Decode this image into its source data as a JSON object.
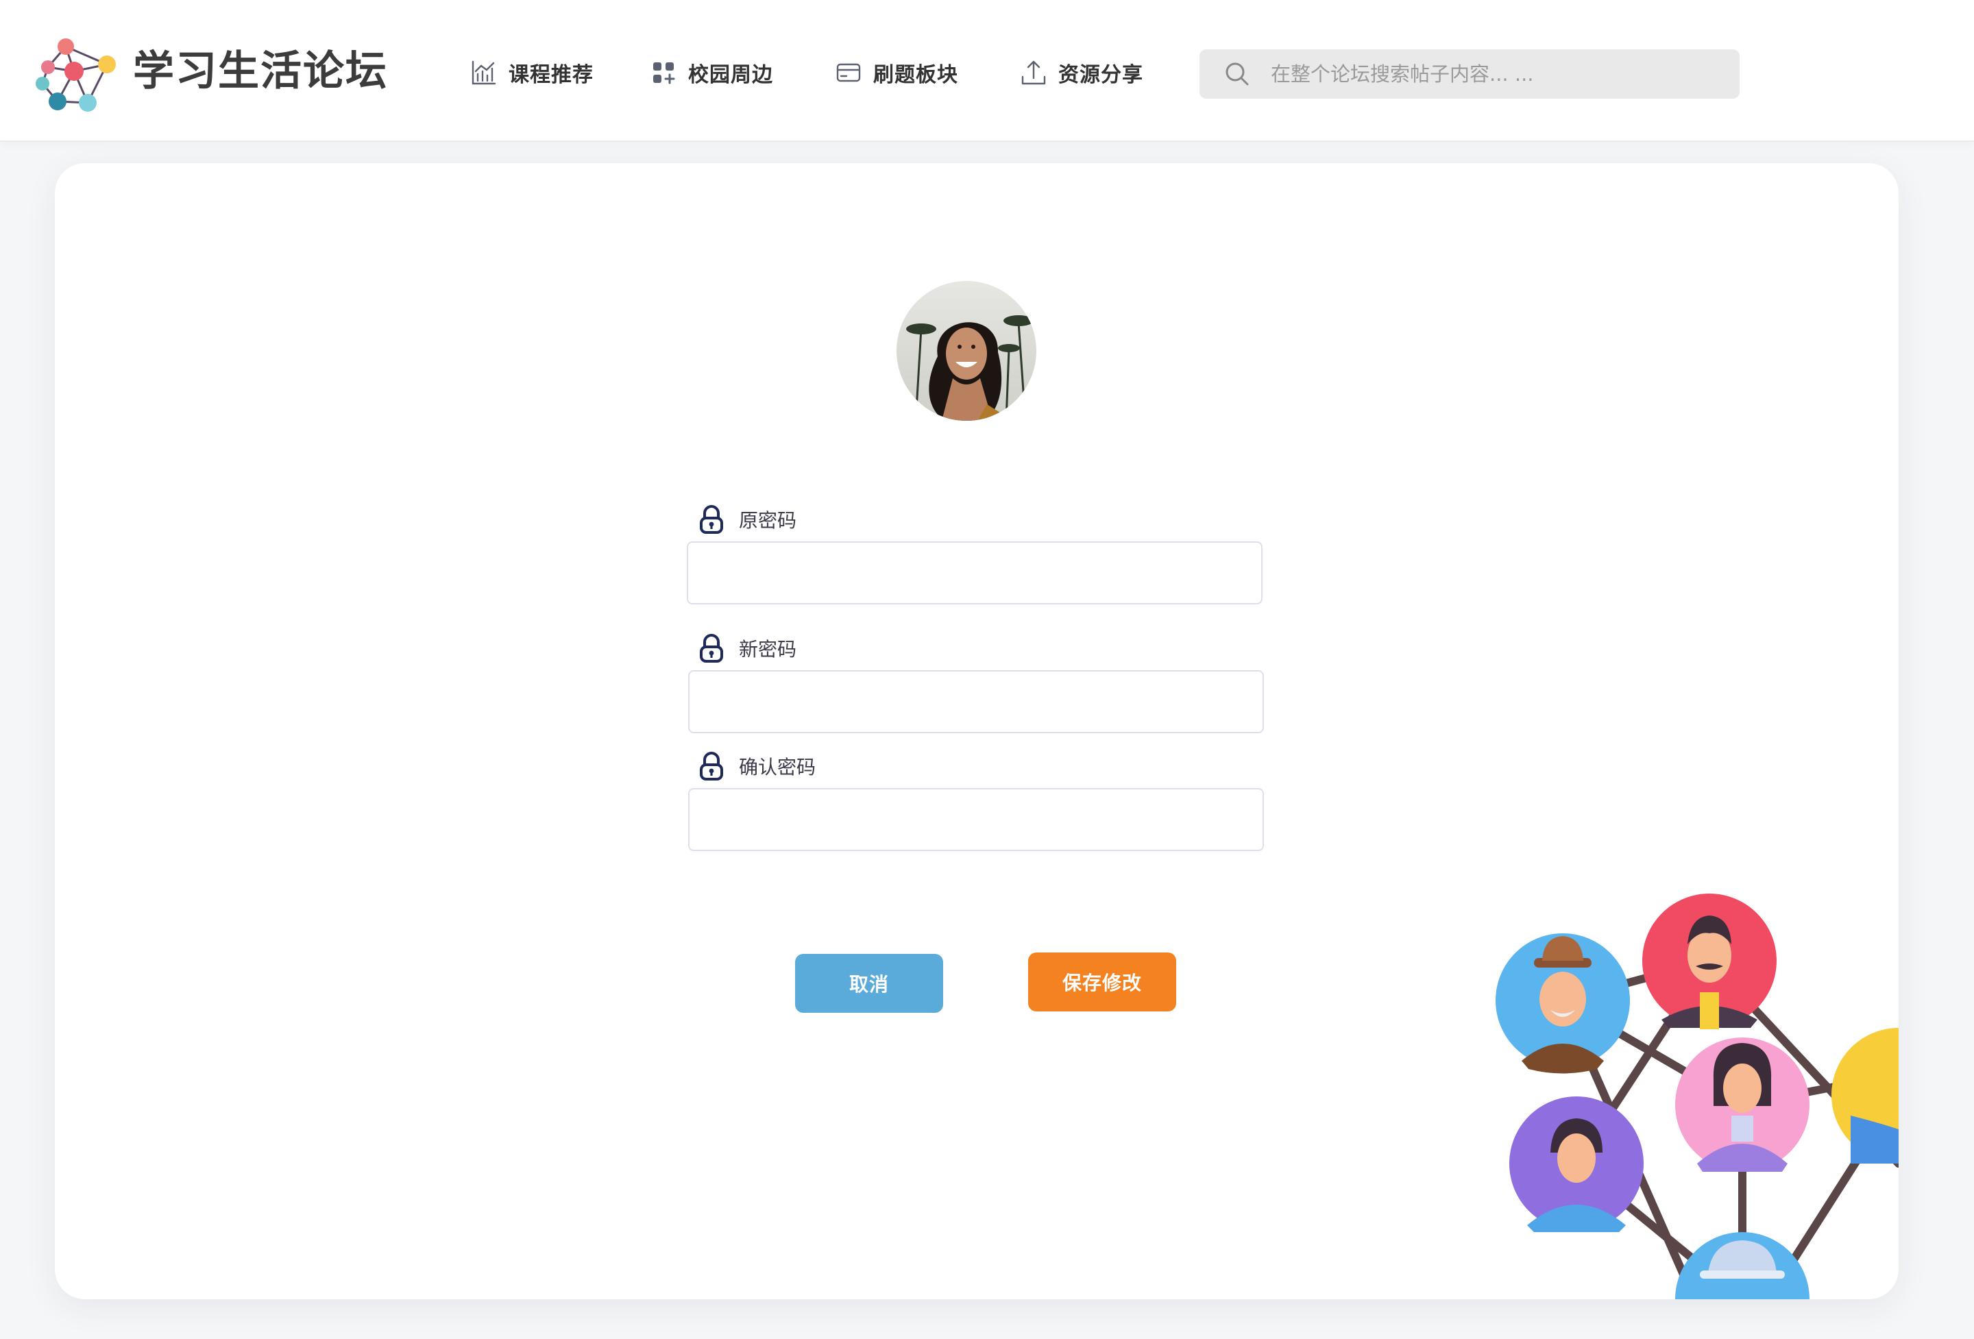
{
  "header": {
    "brand": "学习生活论坛",
    "nav": [
      {
        "label": "课程推荐",
        "icon": "chart-icon"
      },
      {
        "label": "校园周边",
        "icon": "grid-icon"
      },
      {
        "label": "刷题板块",
        "icon": "card-icon"
      },
      {
        "label": "资源分享",
        "icon": "upload-icon"
      }
    ],
    "search": {
      "placeholder": "在整个论坛搜索帖子内容... ...",
      "value": ""
    }
  },
  "form": {
    "fields": [
      {
        "label": "原密码",
        "value": ""
      },
      {
        "label": "新密码",
        "value": ""
      },
      {
        "label": "确认密码",
        "value": ""
      }
    ],
    "cancel_label": "取消",
    "save_label": "保存修改"
  },
  "colors": {
    "primary_text": "#3c3c3c",
    "cancel_button": "#5aabd9",
    "save_button": "#f58220",
    "lock_icon": "#1e2a5a"
  }
}
